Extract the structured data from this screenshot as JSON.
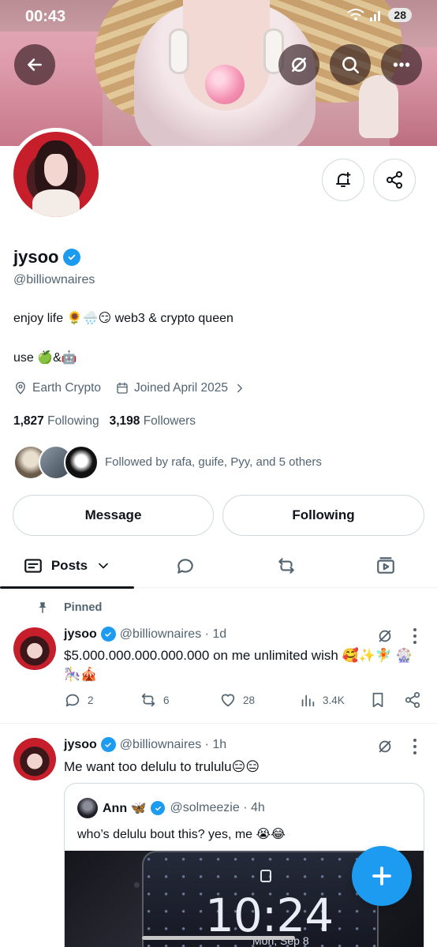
{
  "status_bar": {
    "time": "00:43",
    "battery": "28",
    "signal_icons": [
      "wifi-icon",
      "signal-icon"
    ]
  },
  "header_buttons": [
    "back-arrow-icon",
    "grok-icon",
    "search-icon",
    "more-horizontal-icon"
  ],
  "profile": {
    "display_name": "jysoo",
    "handle": "@billiownaires",
    "bio_line1": "enjoy life 🌻🌧️😏 web3 & crypto queen",
    "bio_line2": "use 🍏&🤖",
    "location": "Earth Crypto",
    "joined": "Joined April 2025",
    "following_count": "1,827",
    "following_label": "Following",
    "followers_count": "3,198",
    "followers_label": "Followers",
    "followed_by": "Followed by rafa, guife, Pyy, and 5 others"
  },
  "buttons": {
    "message": "Message",
    "following": "Following"
  },
  "tabs": {
    "posts": "Posts",
    "icons": [
      "posts-icon",
      "replies-icon",
      "reposts-icon",
      "media-icon"
    ]
  },
  "colors": {
    "accent": "#1d9bf0",
    "text": "#0f1419",
    "muted": "#536471",
    "border": "#cfd9de"
  },
  "posts": [
    {
      "pinned_label": "Pinned",
      "name": "jysoo",
      "handle_time": "@billiownaires · 1d",
      "text": "$5.000.000.000.000.000 on me unlimited wish 🥰✨🧚 🎡🎠🎪",
      "replies": "2",
      "reposts": "6",
      "likes": "28",
      "views": "3.4K"
    },
    {
      "name": "jysoo",
      "handle_time": "@billiownaires · 1h",
      "text": "Me want too delulu to trululu😑😑",
      "quote": {
        "name": "Ann 🦋",
        "handle_time": "@solmeezie · 4h",
        "text": "who’s delulu bout this? yes, me 😭😂",
        "image_clock": "10:24",
        "image_date": "Mon, Sep 8"
      }
    }
  ]
}
